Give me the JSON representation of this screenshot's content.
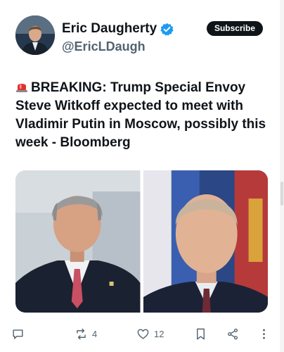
{
  "author": {
    "display_name": "Eric Daugherty",
    "handle": "@EricLDaugh",
    "verified": true
  },
  "subscribe_label": "Subscribe",
  "tweet": {
    "emoji": "siren-emoji",
    "text": "BREAKING: Trump Special Envoy Steve Witkoff expected to meet with Vladimir Putin in Moscow, possibly this week - Bloomberg"
  },
  "media": {
    "count": 2,
    "colors": {
      "left_bg": "#c7cfd6",
      "right_bg": "#2e4a8a"
    }
  },
  "actions": {
    "reply": {
      "icon": "reply-icon",
      "count": ""
    },
    "retweet": {
      "icon": "retweet-icon",
      "count": "4"
    },
    "like": {
      "icon": "heart-icon",
      "count": "12"
    },
    "bookmark": {
      "icon": "bookmark-icon",
      "count": ""
    },
    "share": {
      "icon": "share-icon",
      "count": ""
    },
    "more": {
      "icon": "more-vertical-icon",
      "count": ""
    }
  },
  "colors": {
    "text": "#0f1419",
    "muted": "#536471",
    "verified": "#1d9bf0"
  }
}
